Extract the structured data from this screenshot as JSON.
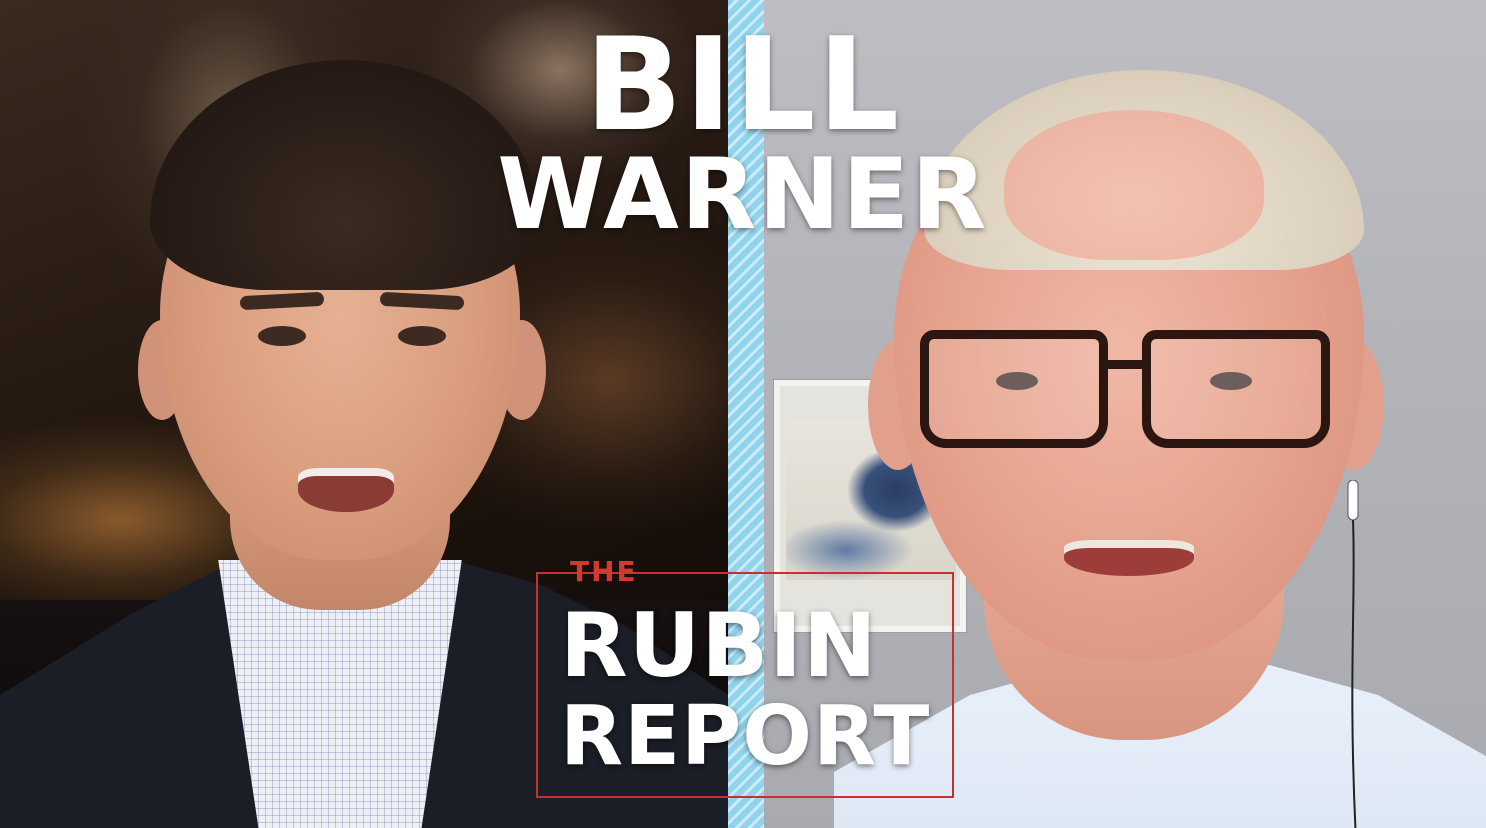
{
  "title": {
    "first_name": "BILL",
    "last_name": "WARNER"
  },
  "logo": {
    "the": "THE",
    "line1": "RUBIN",
    "line2": "REPORT",
    "accent_color": "#c8302c"
  },
  "colors": {
    "divider": "#8fd3ec",
    "title_text": "#ffffff"
  }
}
